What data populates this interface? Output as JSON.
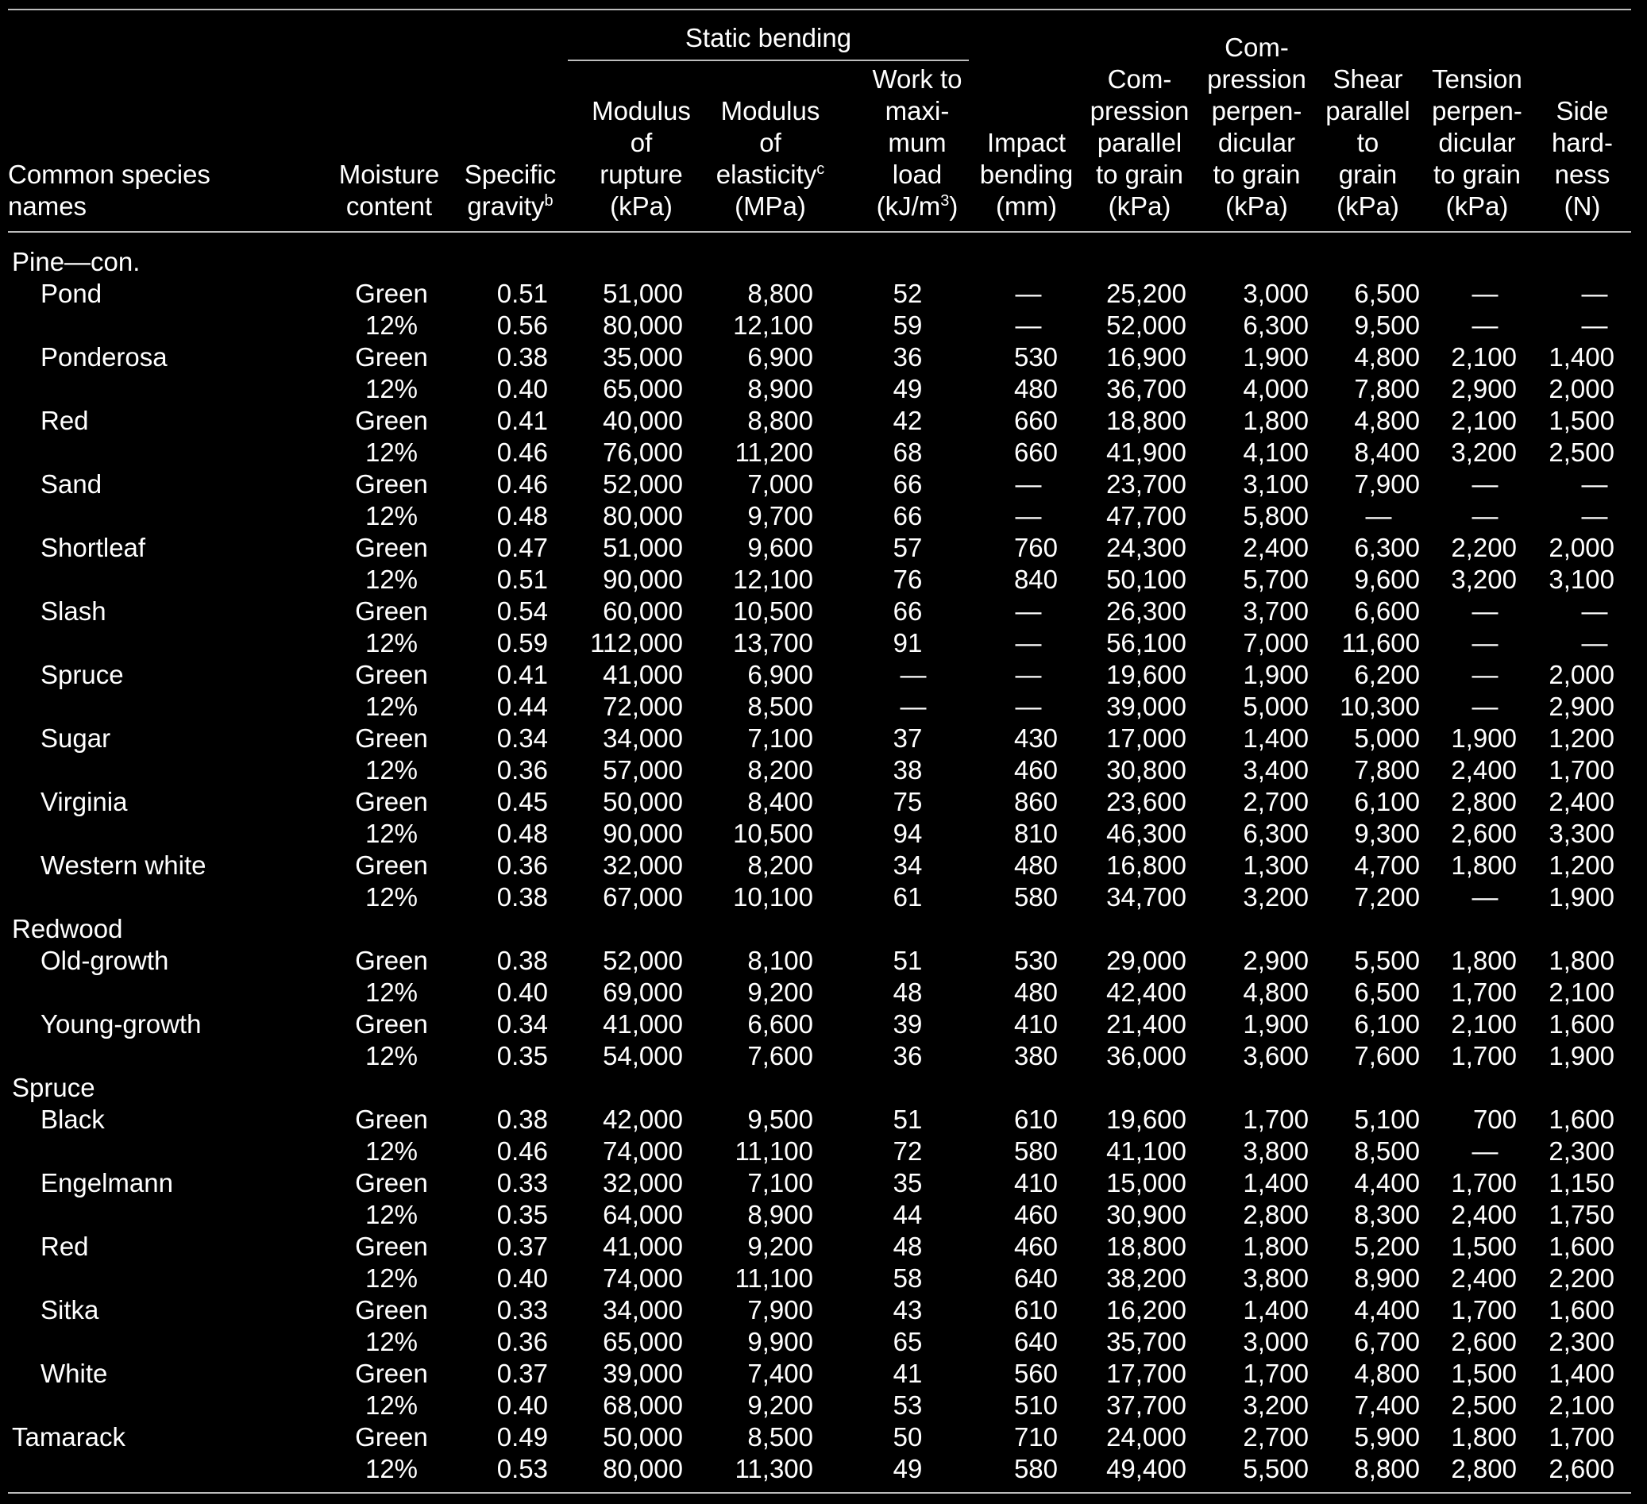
{
  "header": {
    "group_static_bending": "Static bending",
    "columns": [
      {
        "key": "name",
        "label": "Common species\nnames",
        "sup": ""
      },
      {
        "key": "moisture",
        "label": "Moisture\ncontent",
        "sup": ""
      },
      {
        "key": "sg",
        "label": "Specific\ngravity",
        "sup": "b"
      },
      {
        "key": "mor",
        "label": "Modulus\nof\nrupture\n(kPa)",
        "sup": ""
      },
      {
        "key": "moe",
        "label": "Modulus\nof\nelasticity",
        "label_after": "\n(MPa)",
        "sup": "c"
      },
      {
        "key": "work",
        "label": "Work to\nmaxi-\nmum\nload\n(kJ/m",
        "sup": "3",
        "label_after": ")"
      },
      {
        "key": "impact",
        "label": "Impact\nbending\n(mm)",
        "sup": ""
      },
      {
        "key": "comp_par",
        "label": "Com-\npression\nparallel\nto grain\n(kPa)",
        "sup": ""
      },
      {
        "key": "comp_perp",
        "label": "Com-\npression\nperpen-\ndicular\nto grain\n(kPa)",
        "sup": ""
      },
      {
        "key": "shear",
        "label": "Shear\nparallel\nto\ngrain\n(kPa)",
        "sup": ""
      },
      {
        "key": "tension",
        "label": "Tension\nperpen-\ndicular\nto grain\n(kPa)",
        "sup": ""
      },
      {
        "key": "hardness",
        "label": "Side\nhard-\nness\n(N)",
        "sup": ""
      }
    ]
  },
  "rows": [
    {
      "type": "group",
      "name": "Pine—con."
    },
    {
      "type": "sub",
      "name": "Pond",
      "v": [
        "Green",
        "0.51",
        "51,000",
        "8,800",
        "52",
        "—",
        "25,200",
        "3,000",
        "6,500",
        "—",
        "—"
      ]
    },
    {
      "type": "cont",
      "name": "",
      "v": [
        "12%",
        "0.56",
        "80,000",
        "12,100",
        "59",
        "—",
        "52,000",
        "6,300",
        "9,500",
        "—",
        "—"
      ]
    },
    {
      "type": "sub",
      "name": "Ponderosa",
      "v": [
        "Green",
        "0.38",
        "35,000",
        "6,900",
        "36",
        "530",
        "16,900",
        "1,900",
        "4,800",
        "2,100",
        "1,400"
      ]
    },
    {
      "type": "cont",
      "name": "",
      "v": [
        "12%",
        "0.40",
        "65,000",
        "8,900",
        "49",
        "480",
        "36,700",
        "4,000",
        "7,800",
        "2,900",
        "2,000"
      ]
    },
    {
      "type": "sub",
      "name": "Red",
      "v": [
        "Green",
        "0.41",
        "40,000",
        "8,800",
        "42",
        "660",
        "18,800",
        "1,800",
        "4,800",
        "2,100",
        "1,500"
      ]
    },
    {
      "type": "cont",
      "name": "",
      "v": [
        "12%",
        "0.46",
        "76,000",
        "11,200",
        "68",
        "660",
        "41,900",
        "4,100",
        "8,400",
        "3,200",
        "2,500"
      ]
    },
    {
      "type": "sub",
      "name": "Sand",
      "v": [
        "Green",
        "0.46",
        "52,000",
        "7,000",
        "66",
        "—",
        "23,700",
        "3,100",
        "7,900",
        "—",
        "—"
      ]
    },
    {
      "type": "cont",
      "name": "",
      "v": [
        "12%",
        "0.48",
        "80,000",
        "9,700",
        "66",
        "—",
        "47,700",
        "5,800",
        "—",
        "—",
        "—"
      ]
    },
    {
      "type": "sub",
      "name": "Shortleaf",
      "v": [
        "Green",
        "0.47",
        "51,000",
        "9,600",
        "57",
        "760",
        "24,300",
        "2,400",
        "6,300",
        "2,200",
        "2,000"
      ]
    },
    {
      "type": "cont",
      "name": "",
      "v": [
        "12%",
        "0.51",
        "90,000",
        "12,100",
        "76",
        "840",
        "50,100",
        "5,700",
        "9,600",
        "3,200",
        "3,100"
      ]
    },
    {
      "type": "sub",
      "name": "Slash",
      "v": [
        "Green",
        "0.54",
        "60,000",
        "10,500",
        "66",
        "—",
        "26,300",
        "3,700",
        "6,600",
        "—",
        "—"
      ]
    },
    {
      "type": "cont",
      "name": "",
      "v": [
        "12%",
        "0.59",
        "112,000",
        "13,700",
        "91",
        "—",
        "56,100",
        "7,000",
        "11,600",
        "—",
        "—"
      ]
    },
    {
      "type": "sub",
      "name": "Spruce",
      "v": [
        "Green",
        "0.41",
        "41,000",
        "6,900",
        "—",
        "—",
        "19,600",
        "1,900",
        "6,200",
        "—",
        "2,000"
      ]
    },
    {
      "type": "cont",
      "name": "",
      "v": [
        "12%",
        "0.44",
        "72,000",
        "8,500",
        "—",
        "—",
        "39,000",
        "5,000",
        "10,300",
        "—",
        "2,900"
      ]
    },
    {
      "type": "sub",
      "name": "Sugar",
      "v": [
        "Green",
        "0.34",
        "34,000",
        "7,100",
        "37",
        "430",
        "17,000",
        "1,400",
        "5,000",
        "1,900",
        "1,200"
      ]
    },
    {
      "type": "cont",
      "name": "",
      "v": [
        "12%",
        "0.36",
        "57,000",
        "8,200",
        "38",
        "460",
        "30,800",
        "3,400",
        "7,800",
        "2,400",
        "1,700"
      ]
    },
    {
      "type": "sub",
      "name": "Virginia",
      "v": [
        "Green",
        "0.45",
        "50,000",
        "8,400",
        "75",
        "860",
        "23,600",
        "2,700",
        "6,100",
        "2,800",
        "2,400"
      ]
    },
    {
      "type": "cont",
      "name": "",
      "v": [
        "12%",
        "0.48",
        "90,000",
        "10,500",
        "94",
        "810",
        "46,300",
        "6,300",
        "9,300",
        "2,600",
        "3,300"
      ]
    },
    {
      "type": "sub",
      "name": "Western white",
      "v": [
        "Green",
        "0.36",
        "32,000",
        "8,200",
        "34",
        "480",
        "16,800",
        "1,300",
        "4,700",
        "1,800",
        "1,200"
      ]
    },
    {
      "type": "cont",
      "name": "",
      "v": [
        "12%",
        "0.38",
        "67,000",
        "10,100",
        "61",
        "580",
        "34,700",
        "3,200",
        "7,200",
        "—",
        "1,900"
      ]
    },
    {
      "type": "group",
      "name": "Redwood"
    },
    {
      "type": "sub",
      "name": "Old-growth",
      "v": [
        "Green",
        "0.38",
        "52,000",
        "8,100",
        "51",
        "530",
        "29,000",
        "2,900",
        "5,500",
        "1,800",
        "1,800"
      ]
    },
    {
      "type": "cont",
      "name": "",
      "v": [
        "12%",
        "0.40",
        "69,000",
        "9,200",
        "48",
        "480",
        "42,400",
        "4,800",
        "6,500",
        "1,700",
        "2,100"
      ]
    },
    {
      "type": "sub",
      "name": "Young-growth",
      "v": [
        "Green",
        "0.34",
        "41,000",
        "6,600",
        "39",
        "410",
        "21,400",
        "1,900",
        "6,100",
        "2,100",
        "1,600"
      ]
    },
    {
      "type": "cont",
      "name": "",
      "v": [
        "12%",
        "0.35",
        "54,000",
        "7,600",
        "36",
        "380",
        "36,000",
        "3,600",
        "7,600",
        "1,700",
        "1,900"
      ]
    },
    {
      "type": "group",
      "name": "Spruce"
    },
    {
      "type": "sub",
      "name": "Black",
      "v": [
        "Green",
        "0.38",
        "42,000",
        "9,500",
        "51",
        "610",
        "19,600",
        "1,700",
        "5,100",
        "700",
        "1,600"
      ]
    },
    {
      "type": "cont",
      "name": "",
      "v": [
        "12%",
        "0.46",
        "74,000",
        "11,100",
        "72",
        "580",
        "41,100",
        "3,800",
        "8,500",
        "—",
        "2,300"
      ]
    },
    {
      "type": "sub",
      "name": "Engelmann",
      "v": [
        "Green",
        "0.33",
        "32,000",
        "7,100",
        "35",
        "410",
        "15,000",
        "1,400",
        "4,400",
        "1,700",
        "1,150"
      ]
    },
    {
      "type": "cont",
      "name": "",
      "v": [
        "12%",
        "0.35",
        "64,000",
        "8,900",
        "44",
        "460",
        "30,900",
        "2,800",
        "8,300",
        "2,400",
        "1,750"
      ]
    },
    {
      "type": "sub",
      "name": "Red",
      "v": [
        "Green",
        "0.37",
        "41,000",
        "9,200",
        "48",
        "460",
        "18,800",
        "1,800",
        "5,200",
        "1,500",
        "1,600"
      ]
    },
    {
      "type": "cont",
      "name": "",
      "v": [
        "12%",
        "0.40",
        "74,000",
        "11,100",
        "58",
        "640",
        "38,200",
        "3,800",
        "8,900",
        "2,400",
        "2,200"
      ]
    },
    {
      "type": "sub",
      "name": "Sitka",
      "v": [
        "Green",
        "0.33",
        "34,000",
        "7,900",
        "43",
        "610",
        "16,200",
        "1,400",
        "4,400",
        "1,700",
        "1,600"
      ]
    },
    {
      "type": "cont",
      "name": "",
      "v": [
        "12%",
        "0.36",
        "65,000",
        "9,900",
        "65",
        "640",
        "35,700",
        "3,000",
        "6,700",
        "2,600",
        "2,300"
      ]
    },
    {
      "type": "sub",
      "name": "White",
      "v": [
        "Green",
        "0.37",
        "39,000",
        "7,400",
        "41",
        "560",
        "17,700",
        "1,700",
        "4,800",
        "1,500",
        "1,400"
      ]
    },
    {
      "type": "cont",
      "name": "",
      "v": [
        "12%",
        "0.40",
        "68,000",
        "9,200",
        "53",
        "510",
        "37,700",
        "3,200",
        "7,400",
        "2,500",
        "2,100"
      ]
    },
    {
      "type": "groupdata",
      "name": "Tamarack",
      "v": [
        "Green",
        "0.49",
        "50,000",
        "8,500",
        "50",
        "710",
        "24,000",
        "2,700",
        "5,900",
        "1,800",
        "1,700"
      ]
    },
    {
      "type": "cont",
      "name": "",
      "v": [
        "12%",
        "0.53",
        "80,000",
        "11,300",
        "49",
        "580",
        "49,400",
        "5,500",
        "8,800",
        "2,800",
        "2,600"
      ]
    }
  ]
}
